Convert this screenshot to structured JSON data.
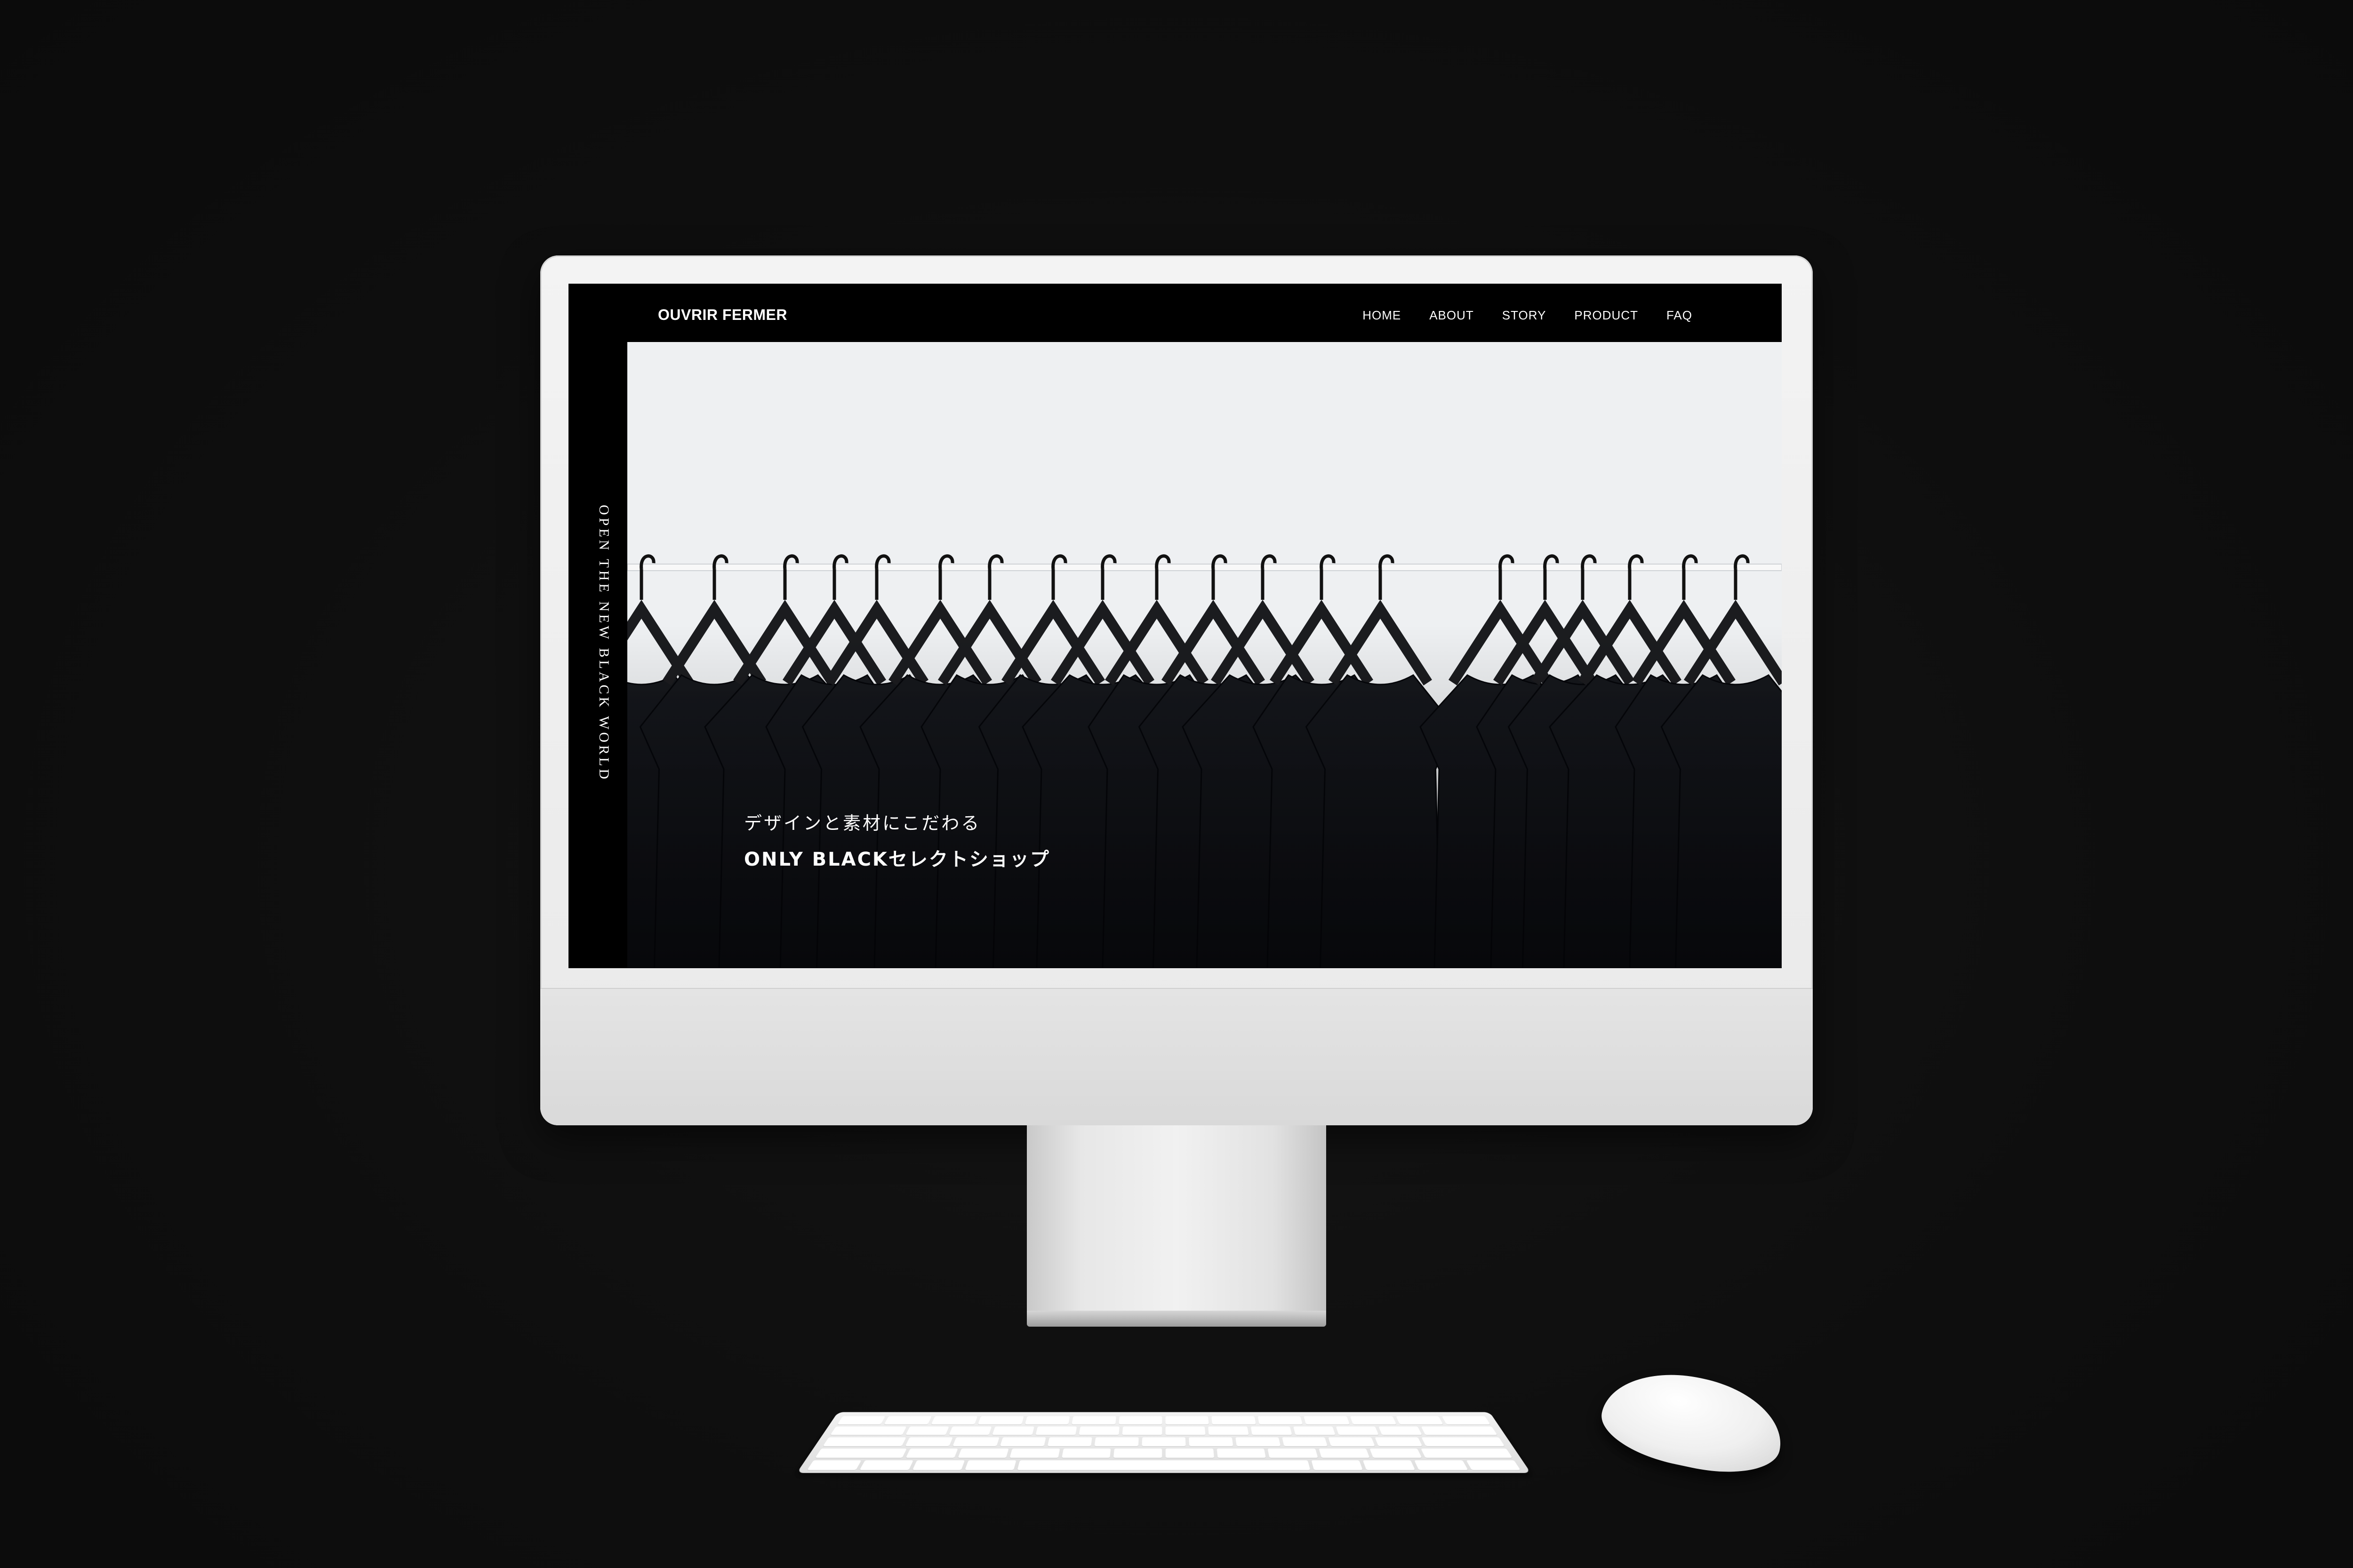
{
  "site": {
    "brand": "OUVRIR FERMER",
    "nav": [
      "HOME",
      "ABOUT",
      "STORY",
      "PRODUCT",
      "FAQ"
    ],
    "side_tagline": "OPEN THE NEW BLACK WORLD",
    "hero": {
      "subtitle": "デザインと素材にこだわる",
      "title": "ONLY BLACKセレクトショップ"
    }
  },
  "colors": {
    "background": "#101010",
    "site_bg": "#000000",
    "hero_wall": "#eceef0",
    "garment": "#101218",
    "hanger": "#1b1c1f",
    "device_silver": "#e9e9e9"
  },
  "icons": [
    "monitor",
    "keyboard",
    "mouse",
    "clothes-hanger"
  ]
}
